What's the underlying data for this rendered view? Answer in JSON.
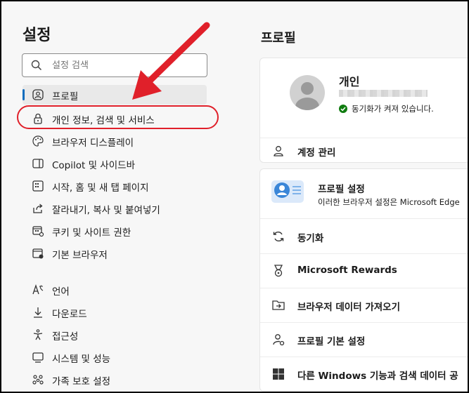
{
  "sidebar": {
    "title": "설정",
    "search_placeholder": "설정 검색",
    "items": [
      {
        "label": "프로필",
        "icon": "profile-icon",
        "active": true
      },
      {
        "label": "개인 정보, 검색 및 서비스",
        "icon": "lock-icon"
      },
      {
        "label": "브라우저 디스플레이",
        "icon": "palette-icon"
      },
      {
        "label": "Copilot 및 사이드바",
        "icon": "sidebar-icon"
      },
      {
        "label": "시작, 홈 및 새 탭 페이지",
        "icon": "home-grid-icon"
      },
      {
        "label": "잘라내기, 복사 및 붙여넣기",
        "icon": "share-icon"
      },
      {
        "label": "쿠키 및 사이트 권한",
        "icon": "cookie-site-icon"
      },
      {
        "label": "기본 브라우저",
        "icon": "default-browser-icon"
      },
      {
        "label": "언어",
        "icon": "language-icon"
      },
      {
        "label": "다운로드",
        "icon": "download-icon"
      },
      {
        "label": "접근성",
        "icon": "accessibility-icon"
      },
      {
        "label": "시스템 및 성능",
        "icon": "system-icon"
      },
      {
        "label": "가족 보호 설정",
        "icon": "family-icon"
      }
    ]
  },
  "main": {
    "title": "프로필",
    "profile": {
      "name": "개인",
      "sync_status": "동기화가 켜져 있습니다.",
      "manage_account": "계정 관리"
    },
    "profile_settings": {
      "title": "프로필 설정",
      "description": "이러한 브라우저 설정은 Microsoft Edge"
    },
    "rows": [
      {
        "label": "동기화",
        "icon": "sync-icon"
      },
      {
        "label": "Microsoft Rewards",
        "icon": "rewards-icon"
      },
      {
        "label": "브라우저 데이터 가져오기",
        "icon": "import-icon"
      },
      {
        "label": "프로필 기본 설정",
        "icon": "profile-preferences-icon"
      },
      {
        "label": "다른 Windows 기능과 검색 데이터 공",
        "icon": "windows-icon"
      }
    ]
  },
  "colors": {
    "accent": "#0f6cbd",
    "annotation_red": "#e0202a",
    "sync_green": "#107c10"
  }
}
